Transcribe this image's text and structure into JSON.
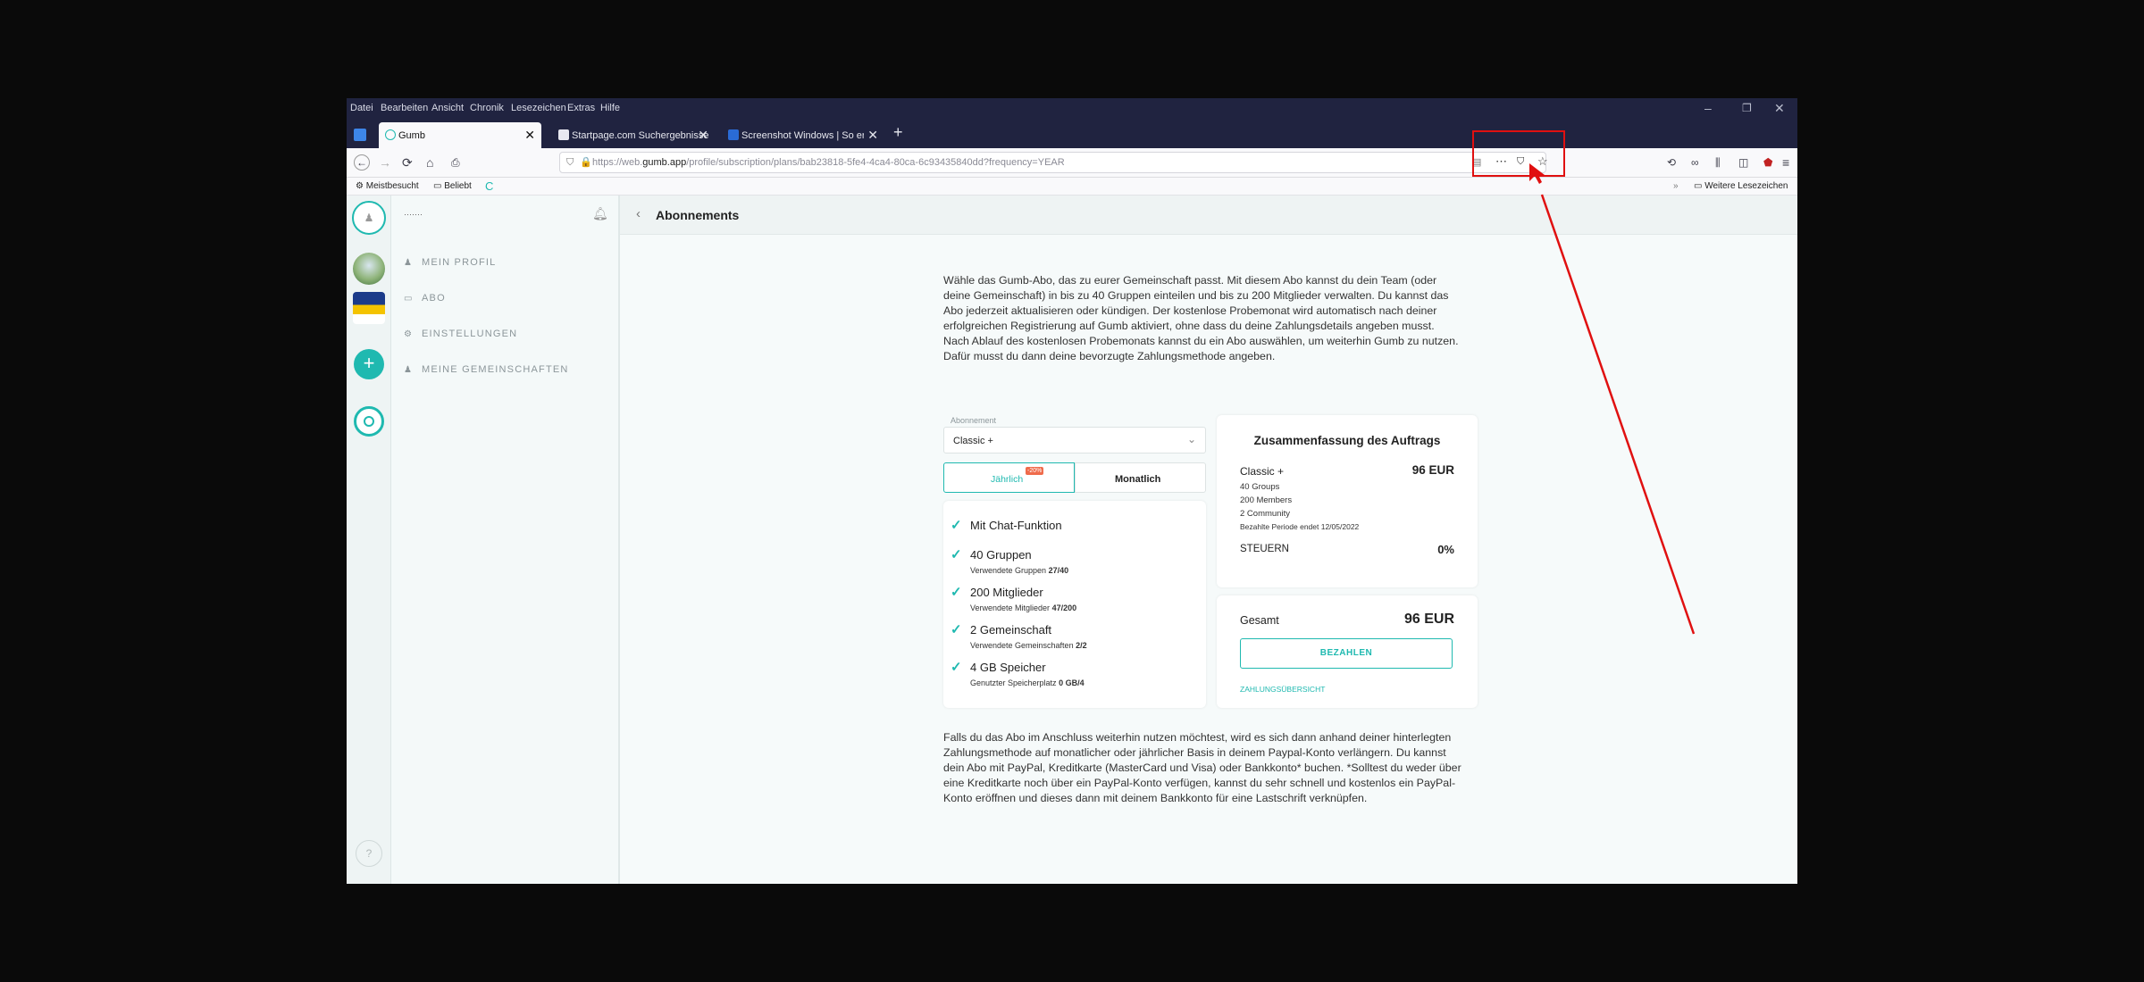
{
  "menubar": {
    "items": [
      "Datei",
      "Bearbeiten",
      "Ansicht",
      "Chronik",
      "Lesezeichen",
      "Extras",
      "Hilfe"
    ]
  },
  "window_controls": {
    "minimize": "–",
    "maximize": "❐",
    "close": "✕"
  },
  "tabs": [
    {
      "label": "Gumb",
      "active": true
    },
    {
      "label": "Startpage.com Suchergebnisse",
      "active": false
    },
    {
      "label": "Screenshot Windows | So erst",
      "active": false
    }
  ],
  "new_tab_label": "+",
  "urlbar": {
    "prefix": "https://web.",
    "domain": "gumb.app",
    "path": "/profile/subscription/plans/bab23818-5fe4-4ca4-80ca-6c93435840dd?frequency=YEAR"
  },
  "bookmarks": {
    "items": [
      "Meistbesucht",
      "Beliebt"
    ],
    "more": "Weitere Lesezeichen"
  },
  "sidebar": {
    "user_name": "·······",
    "nav": [
      {
        "label": "MEIN PROFIL",
        "icon": "person-icon"
      },
      {
        "label": "ABO",
        "icon": "card-icon"
      },
      {
        "label": "EINSTELLUNGEN",
        "icon": "gear-icon"
      },
      {
        "label": "MEINE GEMEINSCHAFTEN",
        "icon": "group-icon"
      }
    ]
  },
  "rail": {
    "add_label": "+",
    "help_label": "?"
  },
  "page": {
    "title": "Abonnements",
    "intro": "Wähle das Gumb-Abo, das zu eurer Gemeinschaft passt. Mit diesem Abo kannst du dein Team (oder deine Gemeinschaft) in bis zu 40 Gruppen einteilen und bis zu 200 Mitglieder verwalten. Du kannst das Abo jederzeit aktualisieren oder kündigen. Der kostenlose Probemonat wird automatisch nach deiner erfolgreichen Registrierung auf Gumb aktiviert, ohne dass du deine Zahlungsdetails angeben musst. Nach Ablauf des kostenlosen Probemonats kannst du ein Abo auswählen, um weiterhin Gumb zu nutzen. Dafür musst du dann deine bevorzugte Zahlungsmethode angeben.",
    "footer": "Falls du das Abo im Anschluss weiterhin nutzen möchtest, wird es sich dann anhand deiner hinterlegten Zahlungsmethode auf monatlicher oder jährlicher Basis in deinem Paypal-Konto verlängern. Du kannst dein Abo mit PayPal, Kreditkarte (MasterCard und Visa) oder Bankkonto* buchen. *Solltest du weder über eine Kreditkarte noch über ein PayPal-Konto verfügen, kannst du sehr schnell und kostenlos ein PayPal-Konto eröffnen und dieses dann mit deinem Bankkonto für eine Lastschrift verknüpfen."
  },
  "plan": {
    "select_label": "Abonnement",
    "selected": "Classic +",
    "tab_yearly": "Jährlich",
    "tab_yearly_badge": "-20%",
    "tab_monthly": "Monatlich",
    "features": [
      {
        "title": "Mit Chat-Funktion",
        "sub_label": "",
        "sub_value": ""
      },
      {
        "title": "40 Gruppen",
        "sub_label": "Verwendete Gruppen",
        "sub_value": "27/40"
      },
      {
        "title": "200 Mitglieder",
        "sub_label": "Verwendete Mitglieder",
        "sub_value": "47/200"
      },
      {
        "title": "2 Gemeinschaft",
        "sub_label": "Verwendete Gemeinschaften",
        "sub_value": "2/2"
      },
      {
        "title": "4 GB Speicher",
        "sub_label": "Genutzter Speicherplatz",
        "sub_value": "0 GB/4"
      }
    ]
  },
  "summary": {
    "title": "Zusammenfassung des Auftrags",
    "plan_name": "Classic +",
    "plan_price": "96 EUR",
    "details": [
      "40 Groups",
      "200 Members",
      "2 Community",
      "Bezahlte Periode endet 12/05/2022"
    ],
    "tax_label": "STEUERN",
    "tax_value": "0%",
    "total_label": "Gesamt",
    "total_value": "96 EUR",
    "pay_button": "BEZAHLEN",
    "overview_link": "ZAHLUNGSÜBERSICHT"
  },
  "colors": {
    "accent": "#1fb9b0",
    "chrome": "#202340",
    "annotation": "#e01010"
  }
}
